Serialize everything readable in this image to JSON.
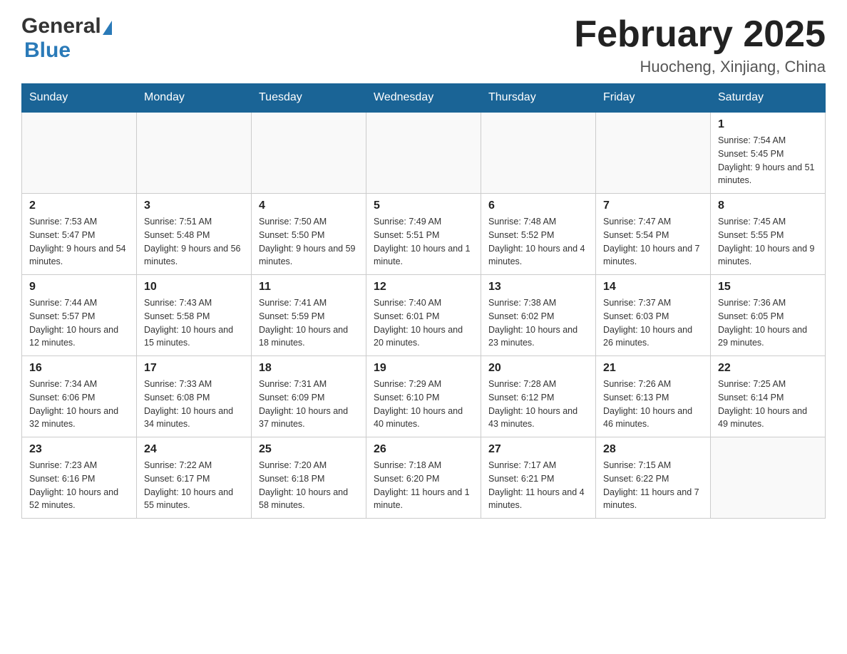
{
  "header": {
    "logo": {
      "general": "General",
      "blue": "Blue"
    },
    "title": "February 2025",
    "location": "Huocheng, Xinjiang, China"
  },
  "weekdays": [
    "Sunday",
    "Monday",
    "Tuesday",
    "Wednesday",
    "Thursday",
    "Friday",
    "Saturday"
  ],
  "weeks": [
    [
      {
        "day": "",
        "info": ""
      },
      {
        "day": "",
        "info": ""
      },
      {
        "day": "",
        "info": ""
      },
      {
        "day": "",
        "info": ""
      },
      {
        "day": "",
        "info": ""
      },
      {
        "day": "",
        "info": ""
      },
      {
        "day": "1",
        "info": "Sunrise: 7:54 AM\nSunset: 5:45 PM\nDaylight: 9 hours and 51 minutes."
      }
    ],
    [
      {
        "day": "2",
        "info": "Sunrise: 7:53 AM\nSunset: 5:47 PM\nDaylight: 9 hours and 54 minutes."
      },
      {
        "day": "3",
        "info": "Sunrise: 7:51 AM\nSunset: 5:48 PM\nDaylight: 9 hours and 56 minutes."
      },
      {
        "day": "4",
        "info": "Sunrise: 7:50 AM\nSunset: 5:50 PM\nDaylight: 9 hours and 59 minutes."
      },
      {
        "day": "5",
        "info": "Sunrise: 7:49 AM\nSunset: 5:51 PM\nDaylight: 10 hours and 1 minute."
      },
      {
        "day": "6",
        "info": "Sunrise: 7:48 AM\nSunset: 5:52 PM\nDaylight: 10 hours and 4 minutes."
      },
      {
        "day": "7",
        "info": "Sunrise: 7:47 AM\nSunset: 5:54 PM\nDaylight: 10 hours and 7 minutes."
      },
      {
        "day": "8",
        "info": "Sunrise: 7:45 AM\nSunset: 5:55 PM\nDaylight: 10 hours and 9 minutes."
      }
    ],
    [
      {
        "day": "9",
        "info": "Sunrise: 7:44 AM\nSunset: 5:57 PM\nDaylight: 10 hours and 12 minutes."
      },
      {
        "day": "10",
        "info": "Sunrise: 7:43 AM\nSunset: 5:58 PM\nDaylight: 10 hours and 15 minutes."
      },
      {
        "day": "11",
        "info": "Sunrise: 7:41 AM\nSunset: 5:59 PM\nDaylight: 10 hours and 18 minutes."
      },
      {
        "day": "12",
        "info": "Sunrise: 7:40 AM\nSunset: 6:01 PM\nDaylight: 10 hours and 20 minutes."
      },
      {
        "day": "13",
        "info": "Sunrise: 7:38 AM\nSunset: 6:02 PM\nDaylight: 10 hours and 23 minutes."
      },
      {
        "day": "14",
        "info": "Sunrise: 7:37 AM\nSunset: 6:03 PM\nDaylight: 10 hours and 26 minutes."
      },
      {
        "day": "15",
        "info": "Sunrise: 7:36 AM\nSunset: 6:05 PM\nDaylight: 10 hours and 29 minutes."
      }
    ],
    [
      {
        "day": "16",
        "info": "Sunrise: 7:34 AM\nSunset: 6:06 PM\nDaylight: 10 hours and 32 minutes."
      },
      {
        "day": "17",
        "info": "Sunrise: 7:33 AM\nSunset: 6:08 PM\nDaylight: 10 hours and 34 minutes."
      },
      {
        "day": "18",
        "info": "Sunrise: 7:31 AM\nSunset: 6:09 PM\nDaylight: 10 hours and 37 minutes."
      },
      {
        "day": "19",
        "info": "Sunrise: 7:29 AM\nSunset: 6:10 PM\nDaylight: 10 hours and 40 minutes."
      },
      {
        "day": "20",
        "info": "Sunrise: 7:28 AM\nSunset: 6:12 PM\nDaylight: 10 hours and 43 minutes."
      },
      {
        "day": "21",
        "info": "Sunrise: 7:26 AM\nSunset: 6:13 PM\nDaylight: 10 hours and 46 minutes."
      },
      {
        "day": "22",
        "info": "Sunrise: 7:25 AM\nSunset: 6:14 PM\nDaylight: 10 hours and 49 minutes."
      }
    ],
    [
      {
        "day": "23",
        "info": "Sunrise: 7:23 AM\nSunset: 6:16 PM\nDaylight: 10 hours and 52 minutes."
      },
      {
        "day": "24",
        "info": "Sunrise: 7:22 AM\nSunset: 6:17 PM\nDaylight: 10 hours and 55 minutes."
      },
      {
        "day": "25",
        "info": "Sunrise: 7:20 AM\nSunset: 6:18 PM\nDaylight: 10 hours and 58 minutes."
      },
      {
        "day": "26",
        "info": "Sunrise: 7:18 AM\nSunset: 6:20 PM\nDaylight: 11 hours and 1 minute."
      },
      {
        "day": "27",
        "info": "Sunrise: 7:17 AM\nSunset: 6:21 PM\nDaylight: 11 hours and 4 minutes."
      },
      {
        "day": "28",
        "info": "Sunrise: 7:15 AM\nSunset: 6:22 PM\nDaylight: 11 hours and 7 minutes."
      },
      {
        "day": "",
        "info": ""
      }
    ]
  ]
}
